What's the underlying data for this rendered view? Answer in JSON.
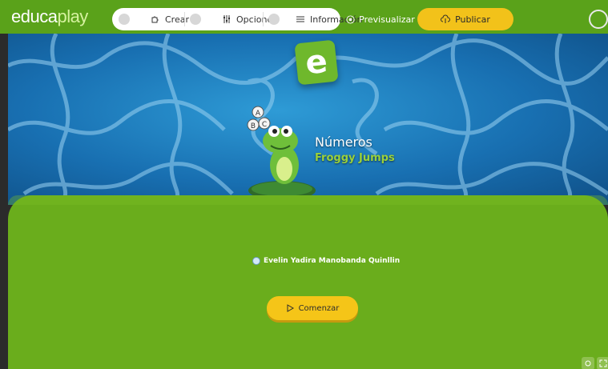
{
  "app": {
    "logo_main": "educa",
    "logo_accent": "play"
  },
  "toolbar": {
    "steps": [
      {
        "label": "Crear",
        "icon": "puzzle-icon"
      },
      {
        "label": "Opciones",
        "icon": "sliders-icon"
      },
      {
        "label": "Información",
        "icon": "list-icon"
      }
    ],
    "preview_label": "Previsualizar",
    "publish_label": "Publicar"
  },
  "banner": {
    "title": "Números",
    "subtitle": "Froggy Jumps",
    "badge_letter": "e",
    "bubble_letters": [
      "A",
      "B",
      "C"
    ]
  },
  "main": {
    "author": "Evelin Yadira Manobanda Quinllin",
    "start_label": "Comenzar"
  },
  "colors": {
    "brand_green": "#5aa21a",
    "main_green": "#6aad1c",
    "publish_yellow": "#f2c21a",
    "banner_blue": "#186fb1"
  }
}
